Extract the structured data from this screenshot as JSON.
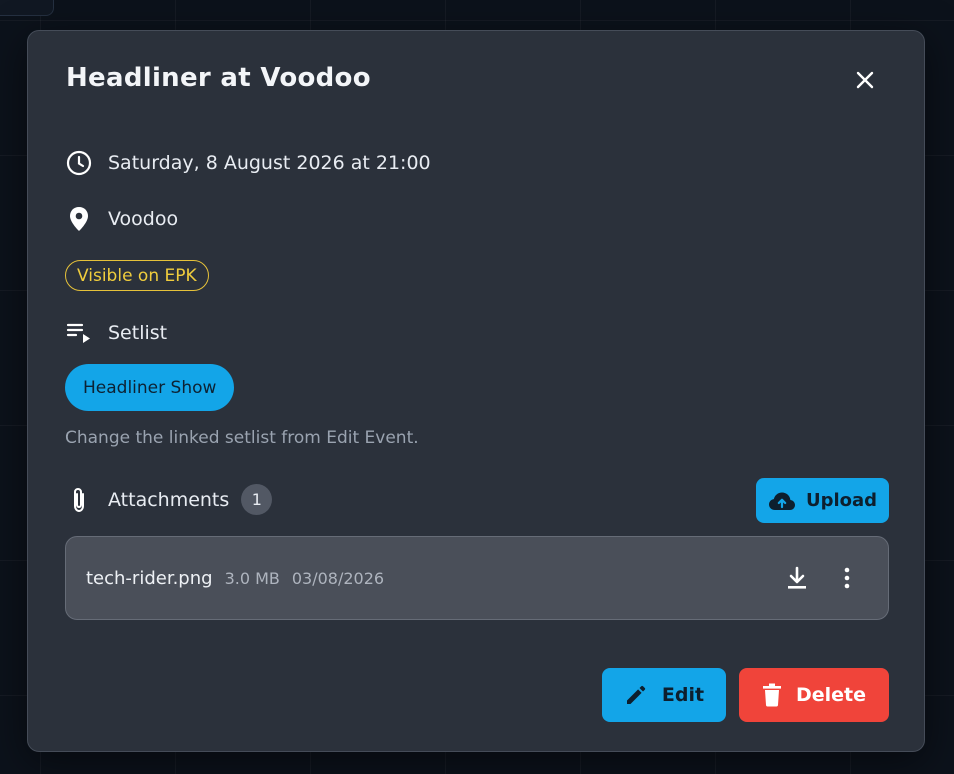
{
  "event": {
    "title": "Headliner at Voodoo",
    "datetime": "Saturday, 8 August 2026 at 21:00",
    "venue": "Voodoo",
    "epk_badge": "Visible on EPK"
  },
  "setlist": {
    "label": "Setlist",
    "linked_name": "Headliner Show",
    "hint": "Change the linked setlist from Edit Event."
  },
  "attachments": {
    "label": "Attachments",
    "count": "1",
    "upload_label": "Upload",
    "files": [
      {
        "name": "tech-rider.png",
        "size": "3.0 MB",
        "date": "03/08/2026"
      }
    ]
  },
  "actions": {
    "edit_label": "Edit",
    "delete_label": "Delete"
  },
  "colors": {
    "accent": "#13a5e8",
    "danger": "#f0443a",
    "epk_badge": "#e6c23a",
    "modal_bg": "#2b313b"
  },
  "icons": {
    "close": "close-icon",
    "datetime": "clock-icon",
    "venue": "location-pin-icon",
    "setlist": "playlist-icon",
    "attachments": "paperclip-icon",
    "upload": "cloud-upload-icon",
    "download": "download-icon",
    "more": "more-vert-icon",
    "edit": "pencil-icon",
    "delete": "trash-icon"
  }
}
